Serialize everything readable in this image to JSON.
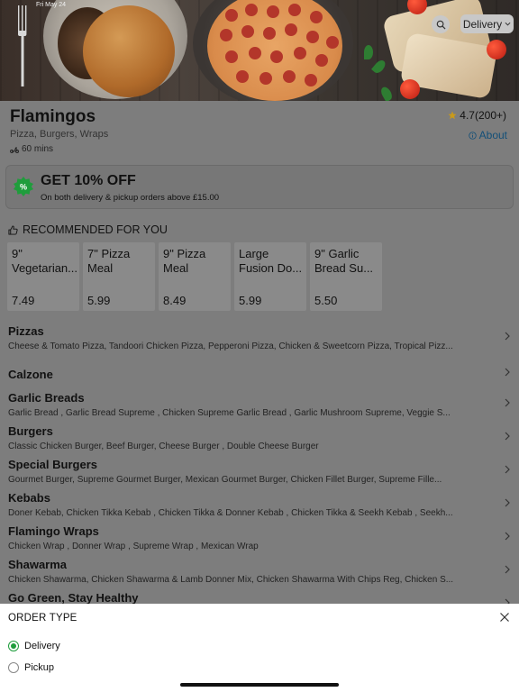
{
  "status_bar": {
    "date": "Fri May 24"
  },
  "hero": {
    "delivery_selector": "Delivery"
  },
  "restaurant": {
    "name": "Flamingos",
    "cuisine": "Pizza, Burgers, Wraps",
    "delivery_time": "60 mins",
    "rating": "4.7(200+)",
    "about_label": "About"
  },
  "offer": {
    "title": "GET 10% OFF",
    "subtitle": "On both delivery & pickup orders above £15.00",
    "badge_color": "#1f9d3c"
  },
  "recommended": {
    "heading": "RECOMMENDED FOR YOU",
    "items": [
      {
        "name": "9\" Vegetarian...",
        "price": "7.49"
      },
      {
        "name": "7\" Pizza Meal",
        "price": "5.99"
      },
      {
        "name": "9\" Pizza Meal",
        "price": "8.49"
      },
      {
        "name": "Large Fusion Do...",
        "price": "5.99"
      },
      {
        "name": "9\" Garlic Bread  Su...",
        "price": "5.50"
      }
    ]
  },
  "categories": [
    {
      "title": "Pizzas",
      "desc": "Cheese & Tomato Pizza, Tandoori Chicken Pizza, Pepperoni Pizza, Chicken & Sweetcorn Pizza, Tropical  Pizz..."
    },
    {
      "title": "Calzone",
      "desc": ""
    },
    {
      "title": "Garlic Breads",
      "desc": "Garlic Bread , Garlic Bread  Supreme , Chicken Supreme Garlic Bread , Garlic Mushroom Supreme, Veggie S..."
    },
    {
      "title": "Burgers",
      "desc": "Classic Chicken Burger, Beef Burger, Cheese Burger , Double Cheese Burger"
    },
    {
      "title": "Special Burgers",
      "desc": "Gourmet Burger, Supreme Gourmet Burger, Mexican Gourmet Burger, Chicken Fillet Burger, Supreme Fille..."
    },
    {
      "title": "Kebabs",
      "desc": "Doner Kebab, Chicken Tikka Kebab , Chicken Tikka & Donner Kebab , Chicken Tikka & Seekh Kebab , Seekh..."
    },
    {
      "title": "Flamingo Wraps",
      "desc": "Chicken Wrap , Donner Wrap , Supreme Wrap , Mexican Wrap"
    },
    {
      "title": "Shawarma",
      "desc": "Chicken Shawarma, Chicken Shawarma & Lamb Donner Mix, Chicken Shawarma With Chips Reg, Chicken S..."
    },
    {
      "title": "Go Green, Stay Healthy",
      "desc": ""
    }
  ],
  "order_sheet": {
    "title": "ORDER TYPE",
    "options": [
      {
        "label": "Delivery",
        "selected": true
      },
      {
        "label": "Pickup",
        "selected": false
      }
    ],
    "accent_color": "#1f9d3c"
  }
}
